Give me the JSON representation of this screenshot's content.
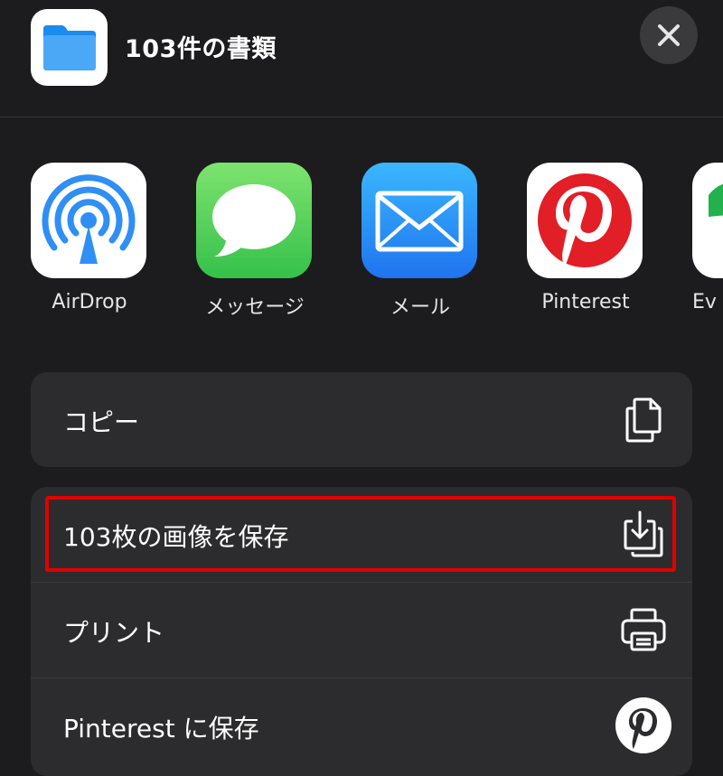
{
  "header": {
    "title": "103件の書類",
    "folder_icon": "folder-icon",
    "close_icon": "close-icon"
  },
  "apps": [
    {
      "label": "AirDrop",
      "icon": "airdrop-icon"
    },
    {
      "label": "メッセージ",
      "icon": "messages-icon"
    },
    {
      "label": "メール",
      "icon": "mail-icon"
    },
    {
      "label": "Pinterest",
      "icon": "pinterest-icon"
    },
    {
      "label": "Ev",
      "icon": "evernote-icon"
    }
  ],
  "actions": {
    "copy": {
      "label": "コピー",
      "icon": "copy-icon"
    },
    "save_images": {
      "label": "103枚の画像を保存",
      "icon": "save-image-icon"
    },
    "print": {
      "label": "プリント",
      "icon": "printer-icon"
    },
    "save_pinterest": {
      "label": "Pinterest に保存",
      "icon": "pinterest-icon"
    }
  },
  "colors": {
    "background": "#1c1c1e",
    "row_background": "#2c2c2e",
    "highlight": "#e00000"
  }
}
